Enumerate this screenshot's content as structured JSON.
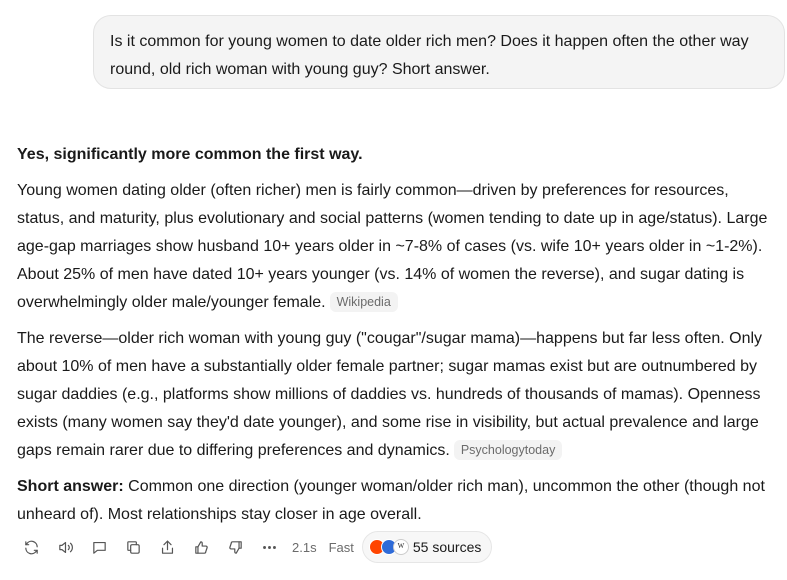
{
  "user_message": "Is it common for young women to date older rich men? Does it happen often the other way round, old rich woman with young guy? Short answer.",
  "answer": {
    "lead": "Yes, significantly more common the first way.",
    "para1": "Young women dating older (often richer) men is fairly common—driven by preferences for resources, status, and maturity, plus evolutionary and social patterns (women tending to date up in age/status). Large age-gap marriages show husband 10+ years older in ~7-8% of cases (vs. wife 10+ years older in ~1-2%). About 25% of men have dated 10+ years younger (vs. 14% of women the reverse), and sugar dating is overwhelmingly older male/younger female.",
    "para1_cite": "Wikipedia",
    "para2": "The reverse—older rich woman with young guy (\"cougar\"/sugar mama)—happens but far less often. Only about 10% of men have a substantially older female partner; sugar mamas exist but are outnumbered by sugar daddies (e.g., platforms show millions of daddies vs. hundreds of thousands of mamas). Openness exists (many women say they'd date younger), and some rise in visibility, but actual prevalence and large gaps remain rarer due to differing preferences and dynamics.",
    "para2_cite": "Psychologytoday",
    "short_label": "Short answer:",
    "short_text": " Common one direction (younger woman/older rich man), uncommon the other (though not unheard of). Most relationships stay closer in age overall."
  },
  "toolbar": {
    "icons": [
      "regenerate-icon",
      "read-aloud-icon",
      "comment-icon",
      "copy-icon",
      "share-icon",
      "thumbs-up-icon",
      "thumbs-down-icon",
      "more-icon"
    ],
    "time": "2.1s",
    "mode": "Fast",
    "sources_label": "55 sources"
  }
}
